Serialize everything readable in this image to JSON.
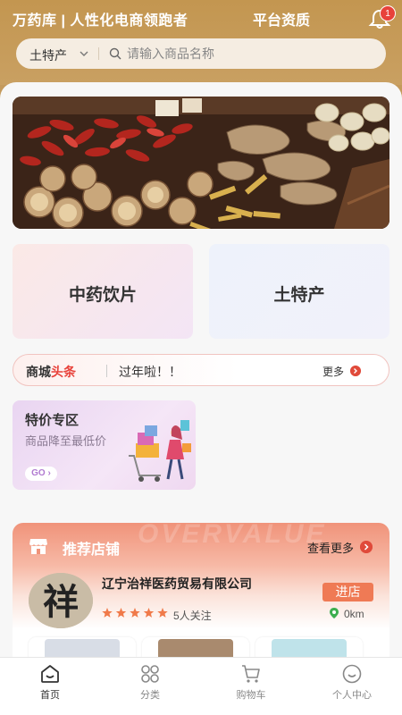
{
  "header": {
    "title": "万药库 | 人性化电商领跑者",
    "qualification": "平台资质",
    "notification_count": "1"
  },
  "search": {
    "category": "土特产",
    "placeholder": "请输入商品名称"
  },
  "categories": [
    {
      "label": "中药饮片"
    },
    {
      "label": "土特产"
    }
  ],
  "news": {
    "logo_prefix": "商城",
    "logo_accent": "头条",
    "text": "过年啦！！",
    "more": "更多"
  },
  "promo": {
    "title": "特价专区",
    "subtitle": "商品降至最低价",
    "go": "GO"
  },
  "recommend": {
    "title": "推荐店铺",
    "watermark": "OVERVALUE",
    "more": "查看更多",
    "store": {
      "logo_char": "祥",
      "name": "辽宁治祥医药贸易有限公司",
      "enter": "进店",
      "rating": 5,
      "followers": "5人关注",
      "distance": "0km"
    }
  },
  "tabbar": [
    {
      "label": "首页",
      "active": true
    },
    {
      "label": "分类"
    },
    {
      "label": "购物车"
    },
    {
      "label": "个人中心"
    }
  ],
  "colors": {
    "brand": "#c49a5c",
    "accent": "#e8413a",
    "button": "#ef7a55"
  }
}
